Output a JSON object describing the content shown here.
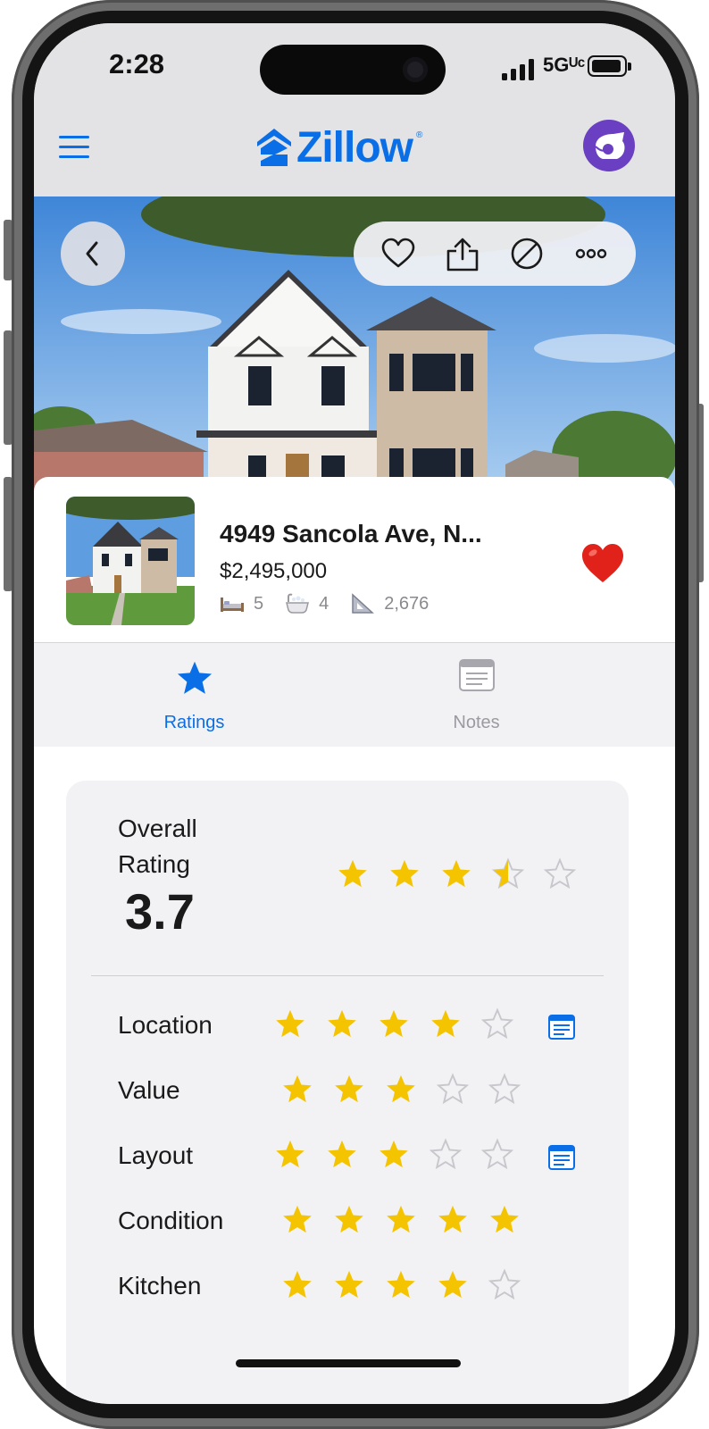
{
  "status_bar": {
    "time": "2:28",
    "network": "5Gᵁᶜ",
    "signal_icon": "signal-bars-icon",
    "battery_icon": "battery-icon"
  },
  "header": {
    "menu_icon": "hamburger-menu-icon",
    "logo_text": "Zillow",
    "logo_mark": "®",
    "brand_color": "#0a6fe6",
    "avatar_color": "#6b3fc2"
  },
  "hero": {
    "back_icon": "chevron-left-icon",
    "actions": [
      "heart-icon",
      "share-icon",
      "hide-icon",
      "more-icon"
    ]
  },
  "listing": {
    "address": "4949 Sancola Ave, N...",
    "price": "$2,495,000",
    "beds": "5",
    "baths": "4",
    "sqft": "2,676",
    "favorited": true
  },
  "tabs": [
    {
      "label": "Ratings",
      "icon": "star-icon",
      "active": true
    },
    {
      "label": "Notes",
      "icon": "notes-icon",
      "active": false
    }
  ],
  "ratings": {
    "overall_label": "Overall Rating",
    "overall_value": "3.7",
    "overall_stars": 3.5,
    "star_color": "#f5c400",
    "categories": [
      {
        "label": "Location",
        "stars": 4,
        "has_note": true
      },
      {
        "label": "Value",
        "stars": 3,
        "has_note": false
      },
      {
        "label": "Layout",
        "stars": 3,
        "has_note": true
      },
      {
        "label": "Condition",
        "stars": 5,
        "has_note": false
      },
      {
        "label": "Kitchen",
        "stars": 4,
        "has_note": false
      }
    ]
  }
}
